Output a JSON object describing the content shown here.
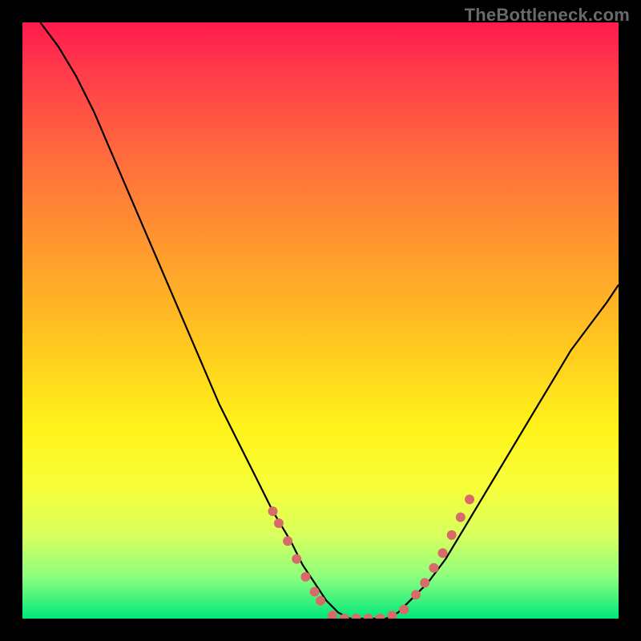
{
  "watermark": {
    "text": "TheBottleneck.com"
  },
  "colors": {
    "frame": "#000000",
    "watermark_text": "#6a6a6a",
    "curve": "#000000",
    "dot": "#d86a6a",
    "gradient_stops": [
      "#ff1a4d",
      "#ff3a4a",
      "#ff6a3d",
      "#ff9a2e",
      "#ffc81f",
      "#fff31a",
      "#f7ff3a",
      "#d8ff5e",
      "#8cff7e",
      "#00e87a"
    ]
  },
  "chart_data": {
    "type": "line",
    "title": "",
    "xlabel": "",
    "ylabel": "",
    "xlim": [
      0,
      100
    ],
    "ylim": [
      0,
      100
    ],
    "x": [
      3,
      6,
      9,
      12,
      15,
      18,
      21,
      24,
      27,
      30,
      33,
      36,
      39,
      42,
      45,
      47,
      49,
      51,
      53,
      55,
      57,
      59,
      61,
      63,
      65,
      68,
      71,
      74,
      77,
      80,
      83,
      86,
      89,
      92,
      95,
      98,
      100
    ],
    "values": [
      100,
      96,
      91,
      85,
      78,
      71,
      64,
      57,
      50,
      43,
      36,
      30,
      24,
      18,
      13,
      9,
      6,
      3,
      1,
      0,
      0,
      0,
      0,
      1,
      3,
      6,
      10,
      15,
      20,
      25,
      30,
      35,
      40,
      45,
      49,
      53,
      56
    ],
    "series": [
      {
        "name": "left-descent-dots",
        "points": [
          [
            42,
            18
          ],
          [
            43,
            16
          ],
          [
            44.5,
            13
          ],
          [
            46,
            10
          ],
          [
            47.5,
            7
          ],
          [
            49,
            4.5
          ],
          [
            50,
            3
          ]
        ]
      },
      {
        "name": "valley-dots",
        "points": [
          [
            52,
            0.5
          ],
          [
            54,
            0
          ],
          [
            56,
            0
          ],
          [
            58,
            0
          ],
          [
            60,
            0
          ],
          [
            62,
            0.5
          ],
          [
            64,
            1.5
          ]
        ]
      },
      {
        "name": "right-ascent-dots",
        "points": [
          [
            66,
            4
          ],
          [
            67.5,
            6
          ],
          [
            69,
            8.5
          ],
          [
            70.5,
            11
          ],
          [
            72,
            14
          ],
          [
            73.5,
            17
          ],
          [
            75,
            20
          ]
        ]
      }
    ],
    "note": "x/y on 0–100 scale; y=0 is the bottom (green) of the gradient, y=100 the top (red)."
  }
}
